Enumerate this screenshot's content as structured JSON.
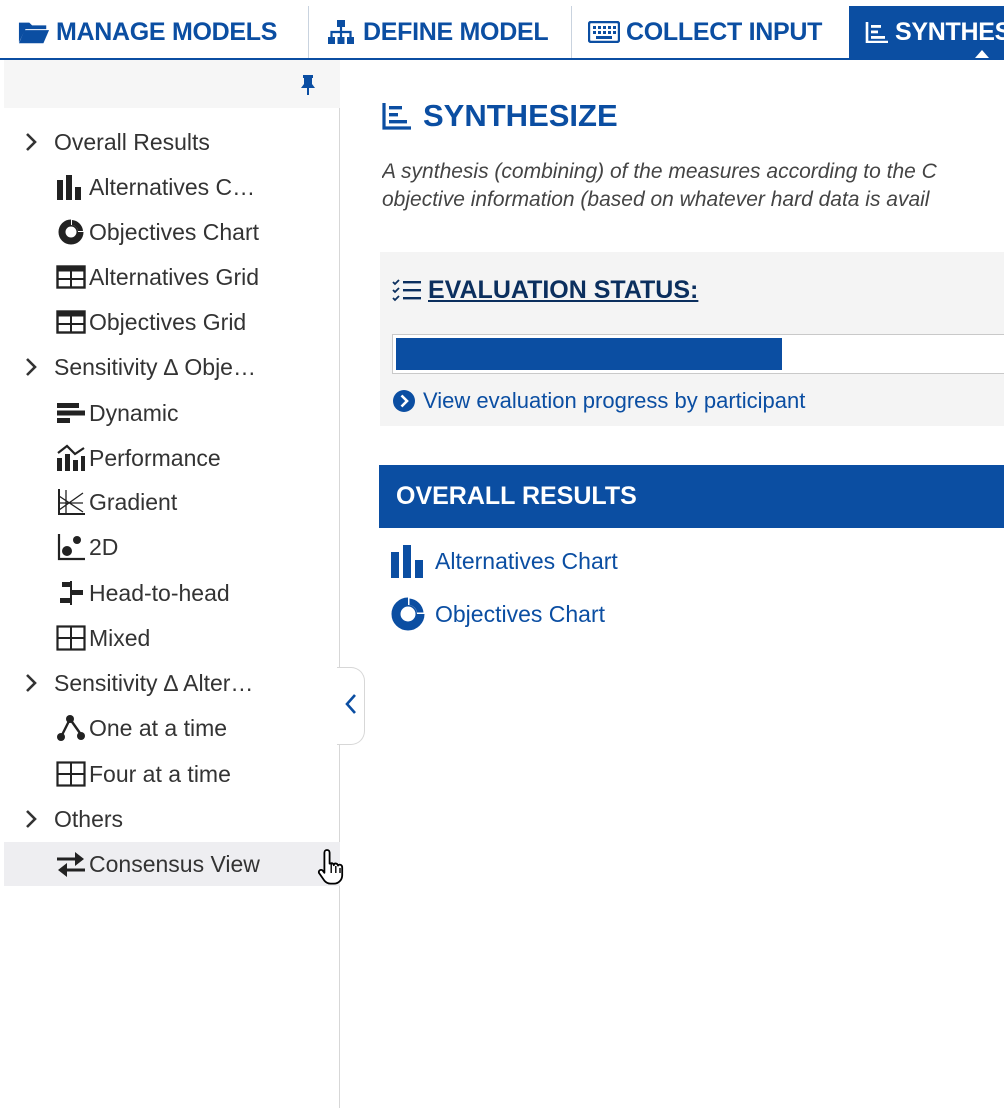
{
  "colors": {
    "brand": "#0b4ea2",
    "text": "#333333",
    "panel": "#f4f4f4",
    "selected": "#eeeef1"
  },
  "tabs": [
    {
      "label": "MANAGE MODELS",
      "icon": "folder-open-icon"
    },
    {
      "label": "DEFINE MODEL",
      "icon": "sitemap-icon"
    },
    {
      "label": "COLLECT INPUT",
      "icon": "keyboard-icon"
    },
    {
      "label": "SYNTHESIZE",
      "icon": "list-chart-icon",
      "active": true
    }
  ],
  "sidebar": {
    "pin_icon": "pin-icon",
    "items": [
      {
        "label": "Overall Results",
        "type": "group",
        "icon": "chevron-right-icon"
      },
      {
        "label": "Alternatives C…",
        "type": "sub",
        "icon": "bar-chart-icon"
      },
      {
        "label": "Objectives Chart",
        "type": "sub",
        "icon": "donut-chart-icon"
      },
      {
        "label": "Alternatives Grid",
        "type": "sub",
        "icon": "grid-icon"
      },
      {
        "label": "Objectives Grid",
        "type": "sub",
        "icon": "grid-icon"
      },
      {
        "label": "Sensitivity ∆ Obje…",
        "type": "group",
        "icon": "chevron-right-icon"
      },
      {
        "label": "Dynamic",
        "type": "sub",
        "icon": "horizontal-bars-icon"
      },
      {
        "label": "Performance",
        "type": "sub",
        "icon": "performance-chart-icon"
      },
      {
        "label": "Gradient",
        "type": "sub",
        "icon": "gradient-chart-icon"
      },
      {
        "label": "2D",
        "type": "sub",
        "icon": "scatter-icon"
      },
      {
        "label": "Head-to-head",
        "type": "sub",
        "icon": "head-to-head-icon"
      },
      {
        "label": "Mixed",
        "type": "sub",
        "icon": "grid-icon"
      },
      {
        "label": "Sensitivity ∆ Alter…",
        "type": "group",
        "icon": "chevron-right-icon"
      },
      {
        "label": "One at a time",
        "type": "sub",
        "icon": "nodes-icon"
      },
      {
        "label": "Four at a time",
        "type": "sub",
        "icon": "grid-icon"
      },
      {
        "label": "Others",
        "type": "group",
        "icon": "chevron-right-icon"
      },
      {
        "label": "Consensus View",
        "type": "sub",
        "icon": "exchange-arrows-icon",
        "selected": true
      }
    ],
    "collapse_icon": "chevron-left-icon"
  },
  "main": {
    "title": "SYNTHESIZE",
    "description_line1": "A synthesis (combining) of the measures according to the C",
    "description_line2": "objective information (based on whatever hard data is avail",
    "evaluation": {
      "title": "EVALUATION STATUS:",
      "progress": 0.63,
      "link": "View evaluation progress by participant"
    },
    "results": {
      "header": "OVERALL RESULTS",
      "links": [
        {
          "label": "Alternatives Chart",
          "icon": "bar-chart-icon"
        },
        {
          "label": "Objectives Chart",
          "icon": "donut-chart-icon"
        }
      ]
    }
  }
}
